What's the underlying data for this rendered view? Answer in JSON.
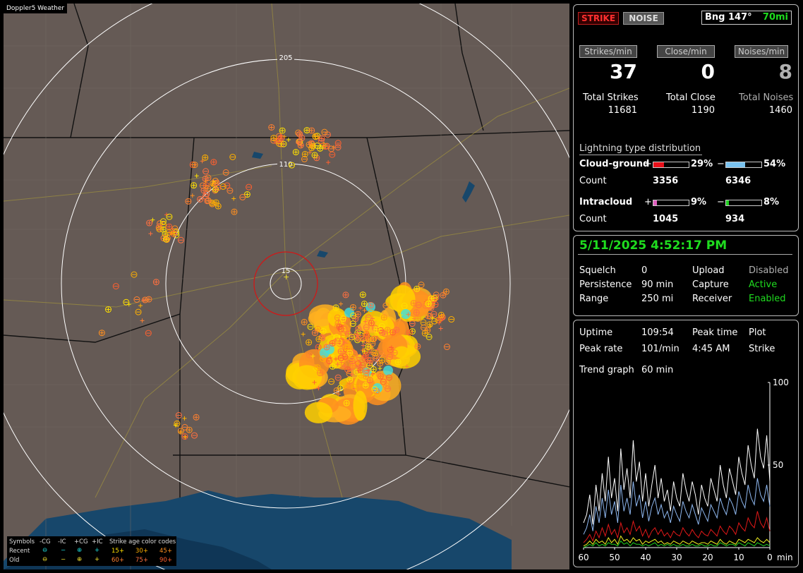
{
  "app_title": "Doppler5 Weather",
  "map": {
    "range_labels": [
      "205",
      "110",
      "15"
    ],
    "legend": {
      "header": {
        "symbols": "Symbols",
        "neg_cg": "-CG",
        "neg_ic": "-IC",
        "pos_cg": "+CG",
        "pos_ic": "+IC",
        "age": "Strike age color codes"
      },
      "rows": [
        {
          "label": "Recent",
          "symbols": [
            "⊖",
            "−",
            "⊕",
            "+"
          ],
          "ages": [
            "15+",
            "30+",
            "45+"
          ]
        },
        {
          "label": "Old",
          "symbols": [
            "⊖",
            "−",
            "⊕",
            "+"
          ],
          "ages": [
            "60+",
            "75+",
            "90+"
          ]
        }
      ],
      "colors": {
        "recent": "#1ed8d8",
        "old": "#f0e030",
        "age_colors": [
          "#ffe000",
          "#ffb000",
          "#ff9020",
          "#ff8030",
          "#ff7040",
          "#ff6030"
        ]
      }
    }
  },
  "buttons": {
    "strike": "STRIKE",
    "noise": "NOISE",
    "bearing": "Bng 147°",
    "distance": "70mi"
  },
  "rates": {
    "strikes_label": "Strikes/min",
    "strikes_value": "37",
    "close_label": "Close/min",
    "close_value": "0",
    "noise_label": "Noises/min",
    "noise_value": "8"
  },
  "totals": {
    "strikes_label": "Total Strikes",
    "strikes_value": "11681",
    "close_label": "Total Close",
    "close_value": "1190",
    "noise_label": "Total Noises",
    "noise_value": "1460"
  },
  "distribution": {
    "title": "Lightning type distribution",
    "cg_label": "Cloud-ground",
    "cg_pos": {
      "sign": "+",
      "percent": "29%",
      "fill": 0.29,
      "color": "#e8101a"
    },
    "cg_neg": {
      "sign": "−",
      "percent": "54%",
      "fill": 0.54,
      "color": "#7ac3f0"
    },
    "count_label": "Count",
    "cg_counts": [
      "3356",
      "6346"
    ],
    "ic_label": "Intracloud",
    "ic_pos": {
      "sign": "+",
      "percent": "9%",
      "fill": 0.09,
      "color": "#e060c0"
    },
    "ic_neg": {
      "sign": "−",
      "percent": "8%",
      "fill": 0.08,
      "color": "#20d020"
    },
    "ic_counts": [
      "1045",
      "934"
    ]
  },
  "status": {
    "datetime": "5/11/2025 4:52:17 PM",
    "squelch_label": "Squelch",
    "squelch_value": "0",
    "persistence_label": "Persistence",
    "persistence_value": "90 min",
    "range_label": "Range",
    "range_value": "250 mi",
    "upload_label": "Upload",
    "upload_value": "Disabled",
    "capture_label": "Capture",
    "capture_value": "Active",
    "receiver_label": "Receiver",
    "receiver_value": "Enabled"
  },
  "stats": {
    "uptime_label": "Uptime",
    "uptime_value": "109:54",
    "peak_time_label": "Peak time",
    "peak_time_value": "4:45 AM",
    "plot_label": "Plot",
    "plot_value": "Strike",
    "peak_rate_label": "Peak rate",
    "peak_rate_value": "101/min",
    "trend_label": "Trend graph",
    "trend_value": "60 min"
  },
  "chart_data": {
    "type": "line",
    "xlabel": "min",
    "x_ticks": [
      "60",
      "50",
      "40",
      "30",
      "20",
      "10",
      "0"
    ],
    "y_ticks": [
      "100",
      "50"
    ],
    "ylim": [
      0,
      100
    ],
    "xlim": [
      60,
      0
    ],
    "series_colors": [
      "#ffffff",
      "#8fb8f0",
      "#e01818",
      "#f0f020",
      "#20d020"
    ],
    "series": [
      {
        "values": [
          15,
          20,
          32,
          14,
          38,
          22,
          45,
          28,
          55,
          30,
          42,
          22,
          60,
          35,
          48,
          30,
          65,
          40,
          52,
          28,
          45,
          25,
          38,
          50,
          30,
          42,
          28,
          35,
          22,
          40,
          30,
          25,
          45,
          35,
          28,
          40,
          32,
          20,
          38,
          30,
          25,
          42,
          35,
          28,
          50,
          38,
          30,
          48,
          40,
          32,
          55,
          45,
          38,
          62,
          50,
          42,
          72,
          55,
          48,
          68,
          40
        ]
      },
      {
        "values": [
          8,
          12,
          20,
          10,
          25,
          15,
          30,
          18,
          35,
          20,
          28,
          15,
          38,
          22,
          30,
          20,
          40,
          25,
          32,
          18,
          28,
          16,
          25,
          30,
          20,
          26,
          18,
          22,
          15,
          25,
          20,
          16,
          28,
          22,
          18,
          26,
          20,
          14,
          24,
          20,
          16,
          26,
          22,
          18,
          30,
          24,
          20,
          30,
          26,
          20,
          34,
          28,
          24,
          38,
          30,
          26,
          42,
          32,
          28,
          38,
          25
        ]
      },
      {
        "values": [
          3,
          5,
          8,
          4,
          10,
          6,
          12,
          7,
          14,
          8,
          11,
          6,
          15,
          9,
          12,
          8,
          16,
          10,
          13,
          7,
          11,
          6,
          10,
          12,
          8,
          11,
          7,
          9,
          6,
          10,
          8,
          7,
          12,
          9,
          7,
          11,
          8,
          6,
          10,
          8,
          7,
          11,
          9,
          7,
          13,
          10,
          8,
          13,
          11,
          8,
          15,
          12,
          10,
          18,
          14,
          12,
          22,
          15,
          12,
          18,
          10
        ]
      },
      {
        "values": [
          1,
          2,
          4,
          2,
          5,
          3,
          4,
          2,
          6,
          3,
          5,
          2,
          7,
          4,
          5,
          3,
          6,
          4,
          5,
          2,
          4,
          3,
          4,
          5,
          3,
          4,
          2,
          3,
          2,
          4,
          3,
          2,
          4,
          3,
          2,
          4,
          3,
          2,
          3,
          3,
          2,
          4,
          3,
          2,
          5,
          3,
          2,
          4,
          3,
          2,
          5,
          4,
          3,
          5,
          4,
          3,
          6,
          4,
          3,
          5,
          3
        ]
      },
      {
        "values": [
          0,
          1,
          2,
          1,
          3,
          1,
          2,
          1,
          3,
          2,
          2,
          1,
          4,
          2,
          3,
          1,
          3,
          2,
          2,
          1,
          2,
          1,
          2,
          3,
          1,
          2,
          1,
          2,
          1,
          2,
          1,
          1,
          2,
          1,
          1,
          2,
          1,
          1,
          2,
          1,
          1,
          2,
          1,
          1,
          3,
          2,
          1,
          2,
          2,
          1,
          3,
          2,
          1,
          3,
          2,
          1,
          3,
          2,
          1,
          2,
          1
        ]
      }
    ]
  }
}
